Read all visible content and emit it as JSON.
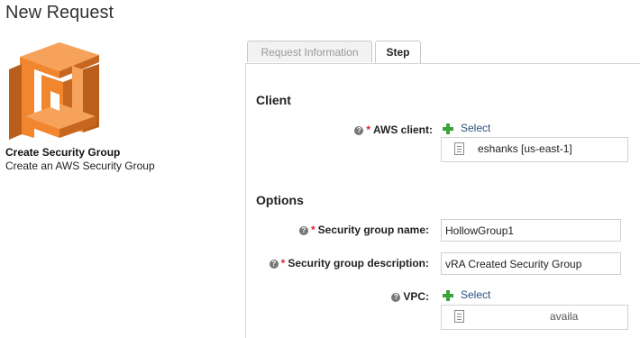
{
  "page": {
    "title": "New Request"
  },
  "catalog_item": {
    "title": "Create Security Group",
    "description": "Create an AWS Security Group",
    "icon": "aws-building-logo-icon"
  },
  "tabs": [
    {
      "label": "Request Information",
      "active": false
    },
    {
      "label": "Step",
      "active": true
    }
  ],
  "client_section": {
    "heading": "Client",
    "aws_client": {
      "label": "AWS client:",
      "select_label": "Select",
      "value": "eshanks [us-east-1]"
    }
  },
  "options_section": {
    "heading": "Options",
    "group_name": {
      "label": "Security group name:",
      "value": "HollowGroup1"
    },
    "group_description": {
      "label": "Security group description:",
      "value": "vRA Created Security Group"
    },
    "vpc": {
      "label": "VPC:",
      "select_label": "Select",
      "value": "availa"
    }
  },
  "colors": {
    "aws_orange": "#f1862f",
    "aws_orange_dark": "#b95f1b",
    "required": "#d9262c",
    "add_green": "#3aa33a"
  }
}
